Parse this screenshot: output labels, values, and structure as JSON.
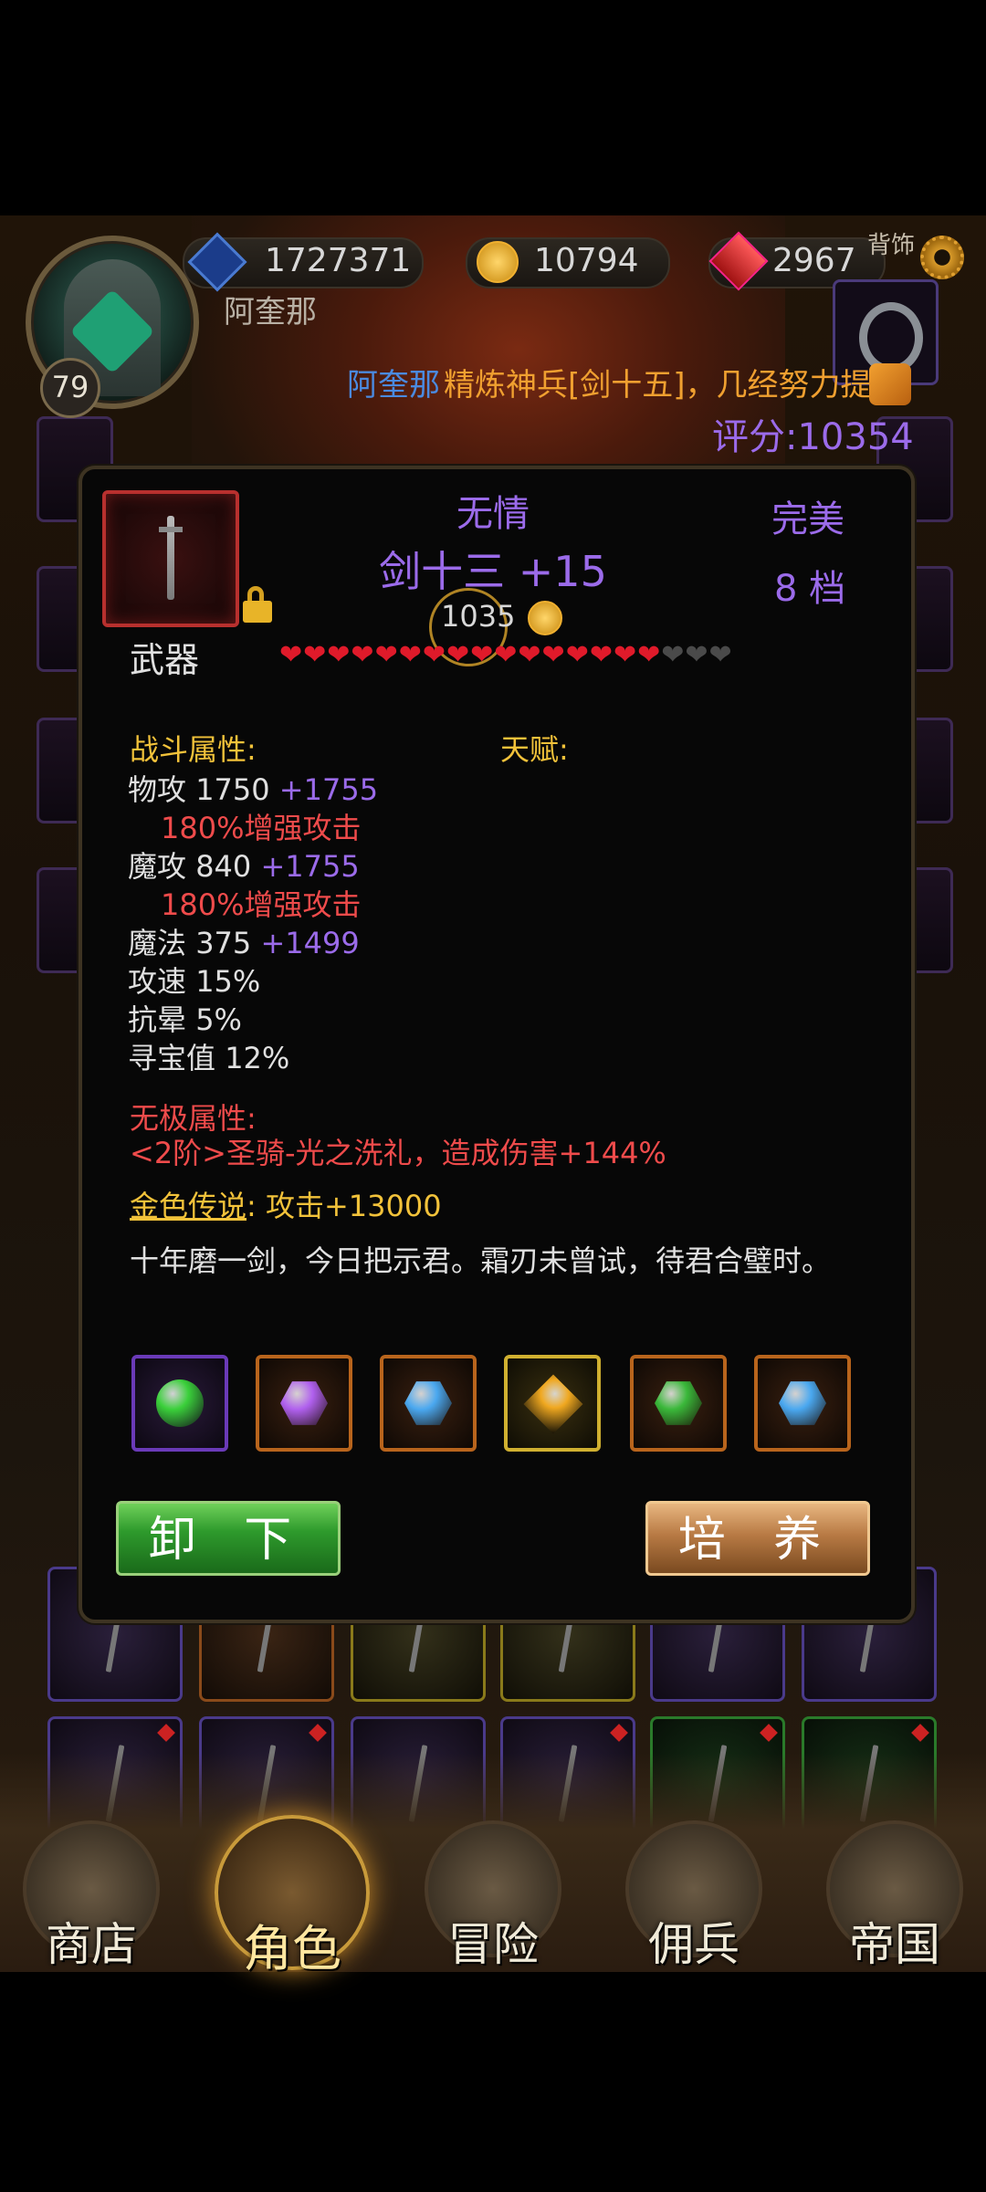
{
  "header": {
    "player_level": "79",
    "player_name": "阿奎那",
    "diamonds": "1727371",
    "gold": "10794",
    "rubies": "2967",
    "back_slot_label": "背饰",
    "score": "评分:10354"
  },
  "news": {
    "player": "阿奎那",
    "text": "精炼神兵[剑十五]，几经努力提"
  },
  "item": {
    "name": "无情",
    "title": "剑十三 +15",
    "quality": "完美",
    "grade": "8 档",
    "type_label": "武器",
    "enhance_cost": "1035",
    "hearts_full": 16,
    "hearts_total": 19,
    "combat_label": "战斗属性:",
    "talent_label": "天赋:",
    "stats": [
      {
        "name": "物攻",
        "base": "1750",
        "bonus": "+1755",
        "extra": "180%增强攻击"
      },
      {
        "name": "魔攻",
        "base": "840",
        "bonus": "+1755",
        "extra": "180%增强攻击"
      },
      {
        "name": "魔法",
        "base": "375",
        "bonus": "+1499",
        "extra": ""
      },
      {
        "name": "攻速",
        "base": "15%",
        "bonus": "",
        "extra": ""
      },
      {
        "name": "抗晕",
        "base": "5%",
        "bonus": "",
        "extra": ""
      },
      {
        "name": "寻宝值",
        "base": "12%",
        "bonus": "",
        "extra": ""
      }
    ],
    "infinite_label": "无极属性:",
    "infinite_text": "<2阶>圣骑-光之洗礼，造成伤害+144%",
    "legend_label": "金色传说",
    "legend_text": ": 攻击+13000",
    "flavor": "十年磨一剑，今日把示君。霜刃未曾试，待君合璧时。",
    "gems": [
      {
        "slot_color": "purple",
        "gem_color": "#3ad03a",
        "shape": "round"
      },
      {
        "slot_color": "orange",
        "gem_color": "#b060ee",
        "shape": "hex"
      },
      {
        "slot_color": "orange",
        "gem_color": "#4aa8f0",
        "shape": "hex"
      },
      {
        "slot_color": "gold",
        "gem_color": "#f0a820",
        "shape": "diamond"
      },
      {
        "slot_color": "orange",
        "gem_color": "#3ab83a",
        "shape": "hex"
      },
      {
        "slot_color": "orange",
        "gem_color": "#4aa8f0",
        "shape": "hex"
      }
    ],
    "unequip_label": "卸 下",
    "train_label": "培 养"
  },
  "nav": [
    {
      "label": "商店",
      "active": false
    },
    {
      "label": "角色",
      "active": true
    },
    {
      "label": "冒险",
      "active": false
    },
    {
      "label": "佣兵",
      "active": false
    },
    {
      "label": "帝国",
      "active": false
    }
  ]
}
